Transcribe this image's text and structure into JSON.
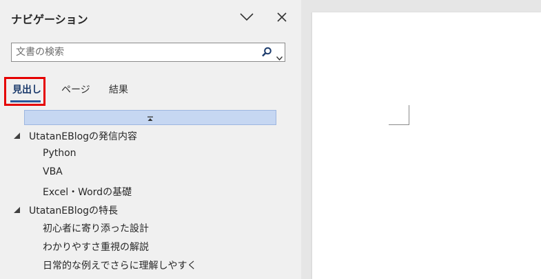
{
  "pane": {
    "title": "ナビゲーション",
    "search_placeholder": "文書の検索"
  },
  "tabs": [
    {
      "label": "見出し",
      "active": true
    },
    {
      "label": "ページ",
      "active": false
    },
    {
      "label": "結果",
      "active": false
    }
  ],
  "headings": [
    {
      "label": "UtatanEBlogの発信内容",
      "level": 1,
      "expanded": true
    },
    {
      "label": "Python",
      "level": 2
    },
    {
      "label": "VBA",
      "level": 2
    },
    {
      "label": "Excel・Wordの基礎",
      "level": 2
    },
    {
      "label": "UtatanEBlogの特長",
      "level": 1,
      "expanded": true
    },
    {
      "label": "初心者に寄り添った設計",
      "level": 2
    },
    {
      "label": "わかりやすさ重視の解説",
      "level": 2
    },
    {
      "label": "日常的な例えでさらに理解しやすく",
      "level": 2
    }
  ],
  "icons": {
    "collapse_pane": "chevron-down-icon",
    "close": "close-icon",
    "search": "search-icon",
    "search_options": "dropdown-arrow-icon",
    "collapse_all": "collapse-up-icon"
  },
  "colors": {
    "active_tab_underline": "#2b579a",
    "highlight_box": "#e50000",
    "collapse_bar": "#c6d7f2"
  }
}
